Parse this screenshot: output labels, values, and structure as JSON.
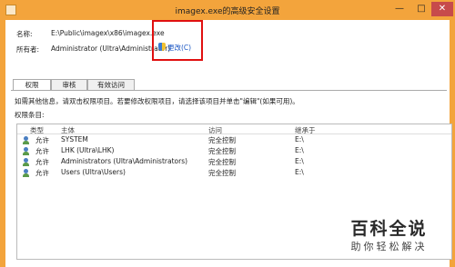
{
  "window": {
    "title": "imagex.exe的高级安全设置"
  },
  "name": {
    "label": "名称:",
    "value": "E:\\Public\\imagex\\x86\\imagex.exe"
  },
  "owner": {
    "label": "所有者:",
    "value": "Administrator (Ultra\\Administrator)",
    "change": "更改(C)"
  },
  "tabs": [
    "权限",
    "审核",
    "有效访问"
  ],
  "info_text": "如需其他信息，请双击权限项目。若要修改权限项目，请选择该项目并单击\"编辑\"(如果可用)。",
  "entries_label": "权限条目:",
  "columns": [
    "类型",
    "主体",
    "访问",
    "继承于"
  ],
  "entries": [
    {
      "type": "允许",
      "principal": "SYSTEM",
      "access": "完全控制",
      "inherited": "E:\\"
    },
    {
      "type": "允许",
      "principal": "LHK (Ultra\\LHK)",
      "access": "完全控制",
      "inherited": "E:\\"
    },
    {
      "type": "允许",
      "principal": "Administrators (Ultra\\Administrators)",
      "access": "完全控制",
      "inherited": "E:\\"
    },
    {
      "type": "允许",
      "principal": "Users (Ultra\\Users)",
      "access": "完全控制",
      "inherited": "E:\\"
    }
  ],
  "watermark": {
    "title": "百科全说",
    "subtitle": "助你轻松解决"
  }
}
